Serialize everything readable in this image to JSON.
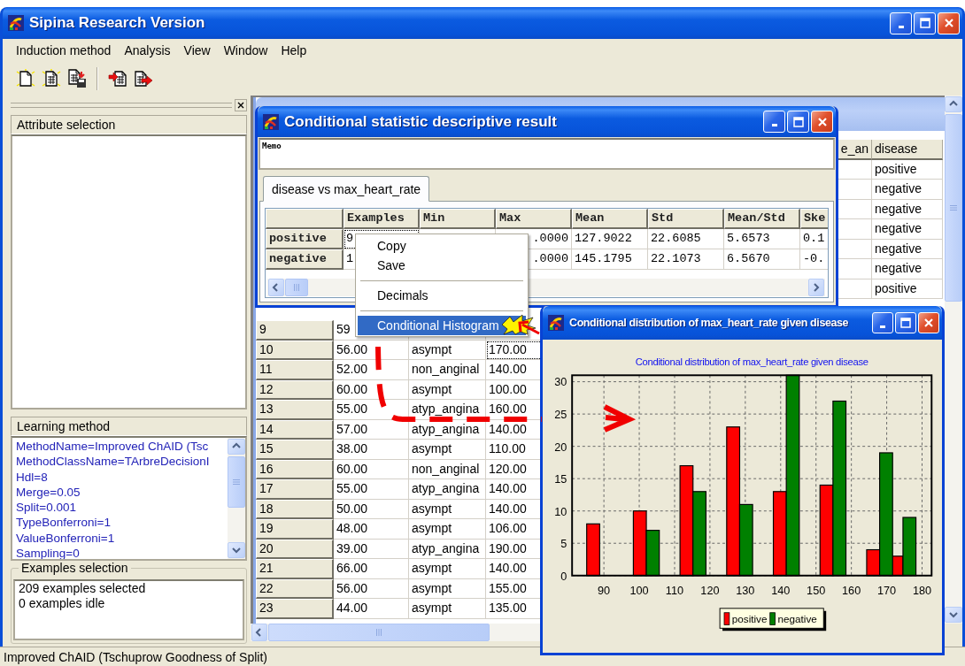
{
  "window": {
    "title": "Sipina Research Version"
  },
  "menu": [
    "Induction method",
    "Analysis",
    "View",
    "Window",
    "Help"
  ],
  "attribute_selection": {
    "title": "Attribute selection"
  },
  "learning_method": {
    "title": "Learning method",
    "lines": [
      "MethodName=Improved ChAID (Tsc",
      "MethodClassName=TArbreDecisionI",
      "Hdl=8",
      "Merge=0.05",
      "Split=0.001",
      "TypeBonferroni=1",
      "ValueBonferroni=1",
      "Sampling=0"
    ]
  },
  "examples_selection": {
    "title": "Examples selection",
    "lines": [
      "209 examples selected",
      "0 examples idle"
    ]
  },
  "data_window": {
    "rows": [
      {
        "cells": [
          "9",
          "59"
        ],
        "focused": false
      },
      {
        "cells": [
          "10",
          "56.00",
          "asympt",
          "170.00"
        ],
        "focused": true
      },
      {
        "cells": [
          "11",
          "52.00",
          "non_anginal",
          "140.00"
        ],
        "focused": false
      },
      {
        "cells": [
          "12",
          "60.00",
          "asympt",
          "100.00"
        ],
        "focused": false
      },
      {
        "cells": [
          "13",
          "55.00",
          "atyp_angina",
          "160.00"
        ],
        "focused": false
      },
      {
        "cells": [
          "14",
          "57.00",
          "atyp_angina",
          "140.00"
        ],
        "focused": false
      },
      {
        "cells": [
          "15",
          "38.00",
          "asympt",
          "110.00"
        ],
        "focused": false
      },
      {
        "cells": [
          "16",
          "60.00",
          "non_anginal",
          "120.00"
        ],
        "focused": false
      },
      {
        "cells": [
          "17",
          "55.00",
          "atyp_angina",
          "140.00"
        ],
        "focused": false
      },
      {
        "cells": [
          "18",
          "50.00",
          "asympt",
          "140.00"
        ],
        "focused": false
      },
      {
        "cells": [
          "19",
          "48.00",
          "asympt",
          "106.00"
        ],
        "focused": false
      },
      {
        "cells": [
          "20",
          "39.00",
          "atyp_angina",
          "190.00"
        ],
        "focused": false
      },
      {
        "cells": [
          "21",
          "66.00",
          "asympt",
          "140.00"
        ],
        "focused": false
      },
      {
        "cells": [
          "22",
          "56.00",
          "asympt",
          "155.00"
        ],
        "focused": false
      },
      {
        "cells": [
          "23",
          "44.00",
          "asympt",
          "135.00"
        ],
        "focused": false
      }
    ],
    "right_columns": [
      "e_an",
      "disease"
    ],
    "disease_values": [
      "positive",
      "negative",
      "negative",
      "negative",
      "negative",
      "negative",
      "positive"
    ]
  },
  "stat_window": {
    "title": "Conditional statistic descriptive result",
    "memo": "Memo",
    "tabs": [
      {
        "label": "disease vs max_heart_rate",
        "selected": true
      }
    ],
    "columns": [
      "Examples",
      "Min",
      "Max",
      "Mean",
      "Std",
      "Mean/Std",
      "Ske"
    ],
    "rows": [
      {
        "label": "positive",
        "examples": "9",
        "max": ".0000",
        "mean": "127.9022",
        "std": "22.6085",
        "mean_std": "5.6573",
        "ske": "0.1",
        "focused": true
      },
      {
        "label": "negative",
        "examples": "1",
        "max": ".0000",
        "mean": "145.1795",
        "std": "22.1073",
        "mean_std": "6.5670",
        "ske": "-0.",
        "focused": false
      }
    ]
  },
  "context_menu": {
    "items": [
      {
        "kind": "item",
        "label": "Copy",
        "selected": false
      },
      {
        "kind": "item",
        "label": "Save",
        "selected": false
      },
      {
        "kind": "separator"
      },
      {
        "kind": "item",
        "label": "Decimals",
        "selected": false
      },
      {
        "kind": "separator"
      },
      {
        "kind": "item",
        "label": "Conditional Histogram",
        "selected": true
      }
    ]
  },
  "chart_window": {
    "title": "Conditional distribution of max_heart_rate given disease",
    "chart_data": {
      "type": "bar",
      "title": "Conditional distribution of max_heart_rate given disease",
      "x": [
        88.8,
        102,
        115.2,
        128.4,
        141.6,
        154.8,
        168,
        174.6
      ],
      "series": [
        {
          "name": "positive",
          "color": "#ff0000",
          "values": [
            8,
            10,
            17,
            23,
            13,
            14,
            4,
            3
          ]
        },
        {
          "name": "negative",
          "color": "#008000",
          "values": [
            null,
            7,
            13,
            11,
            31,
            27,
            19,
            9
          ]
        }
      ],
      "xlim": [
        81,
        182.7
      ],
      "ylim": [
        0,
        31
      ],
      "xticks": [
        90,
        100,
        110,
        120,
        130,
        140,
        150,
        160,
        170,
        180
      ],
      "yticks": [
        0,
        5,
        10,
        15,
        20,
        25,
        30
      ],
      "grid": true,
      "legend": "bottom"
    }
  },
  "status_bar": "Improved ChAID (Tschuprow Goodness of Split)"
}
